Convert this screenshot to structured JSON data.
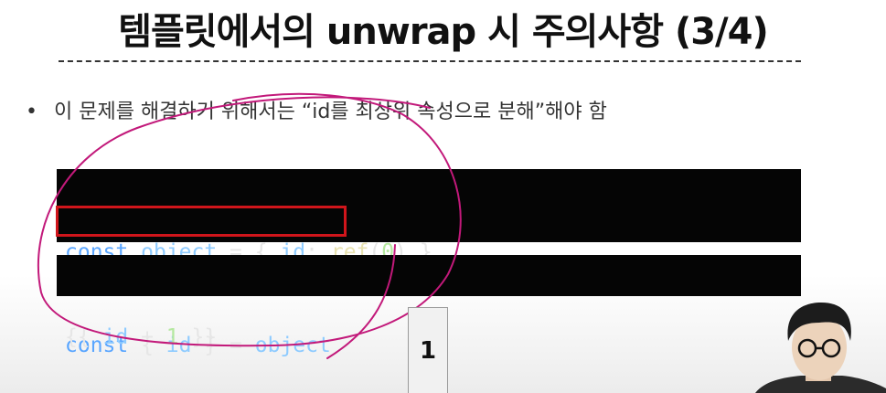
{
  "slide": {
    "title": "템플릿에서의 unwrap 시 주의사항 (3/4)",
    "bullet_marker": "•",
    "bullet_text": "이 문제를 해결하기 위해서는 “id를 최상위 속성으로 분해”해야 함",
    "page_number": "1"
  },
  "code_block_1": {
    "line1": {
      "kw": "const",
      "var": "object",
      "op1": " = { ",
      "prop": "id",
      "colon": ": ",
      "fn": "ref",
      "paren_open": "(",
      "num": "0",
      "paren_close": ") }"
    },
    "line2": {
      "kw": "const",
      "brace_open": " { ",
      "prop": "id",
      "brace_close": " } = ",
      "var": "object"
    }
  },
  "code_block_2": {
    "open": "{{ ",
    "prop": "id",
    "op": " + ",
    "num": "1",
    "close": " }}"
  },
  "colors": {
    "keyword": "#5aa6ff",
    "highlight_box": "#d0151b",
    "annotation_pen": "#c2197a"
  },
  "presenter": {
    "icon": "presenter-webcam-icon"
  }
}
